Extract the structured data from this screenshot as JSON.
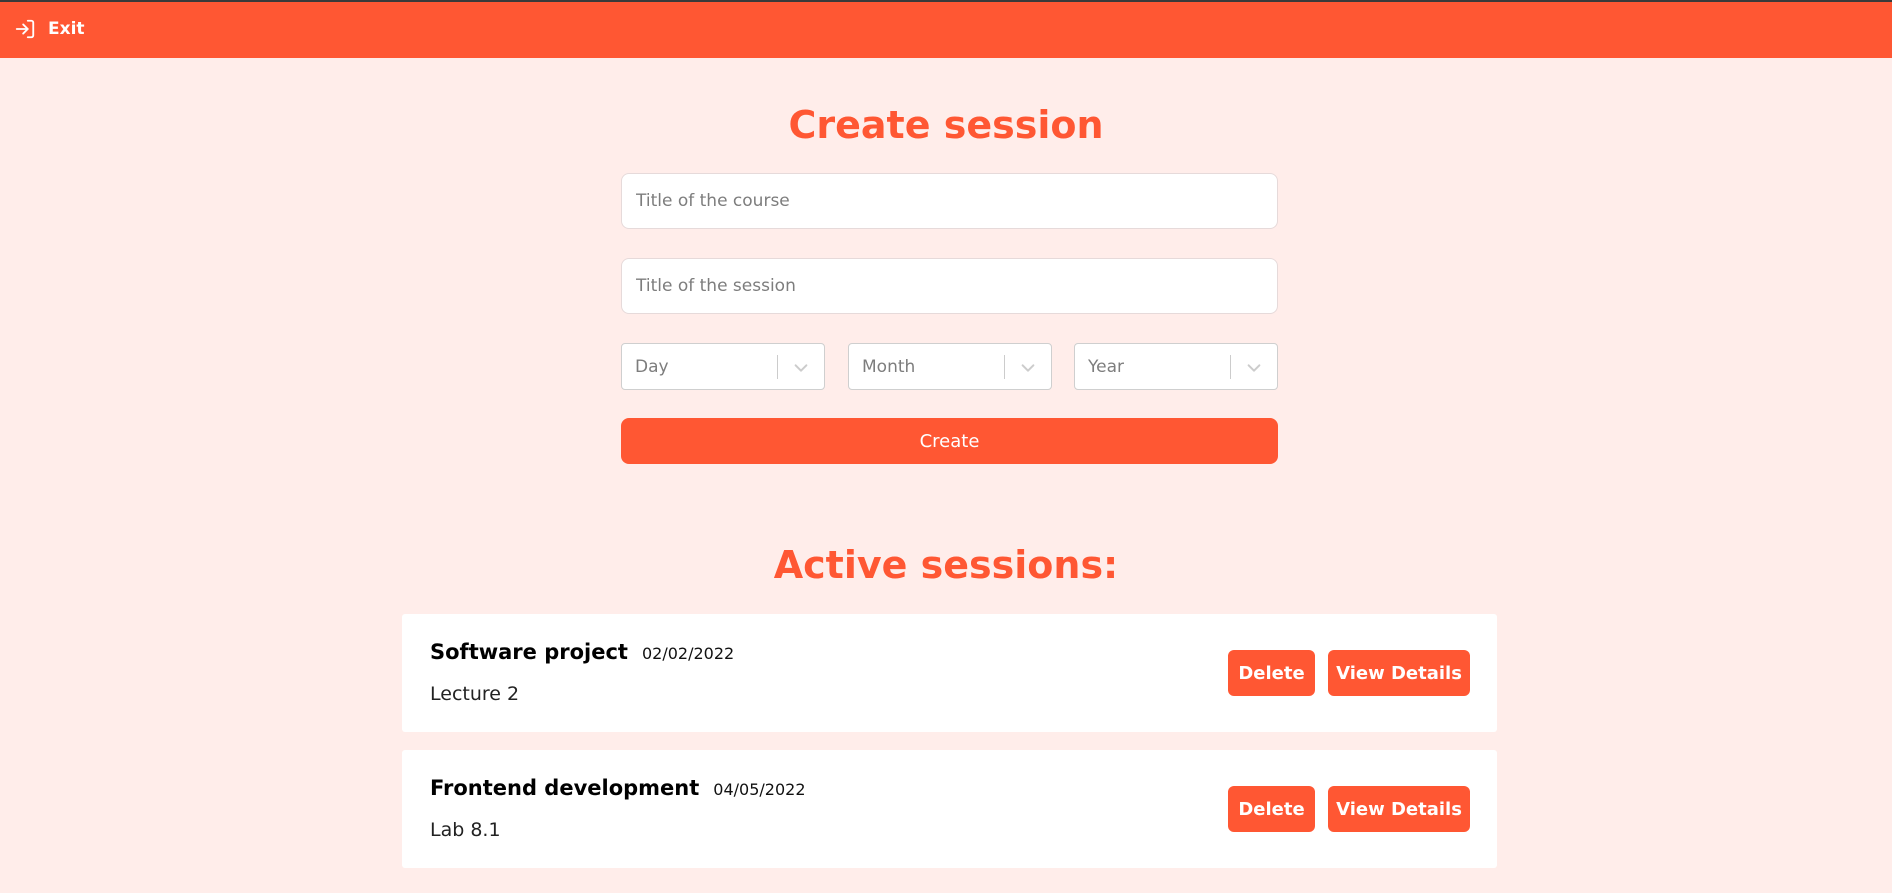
{
  "topbar": {
    "exit_label": "Exit",
    "exit_icon": "sign-in-icon"
  },
  "create": {
    "heading": "Create session",
    "course_placeholder": "Title of the course",
    "session_placeholder": "Title of the session",
    "day_placeholder": "Day",
    "month_placeholder": "Month",
    "year_placeholder": "Year",
    "button_label": "Create"
  },
  "active": {
    "heading": "Active sessions:",
    "sessions": [
      {
        "title": "Software project",
        "date": "02/02/2022",
        "subtitle": "Lecture 2",
        "delete_label": "Delete",
        "details_label": "View Details"
      },
      {
        "title": "Frontend development",
        "date": "04/05/2022",
        "subtitle": "Lab 8.1",
        "delete_label": "Delete",
        "details_label": "View Details"
      }
    ]
  },
  "colors": {
    "accent": "#ff5733",
    "background": "#ffedea"
  }
}
